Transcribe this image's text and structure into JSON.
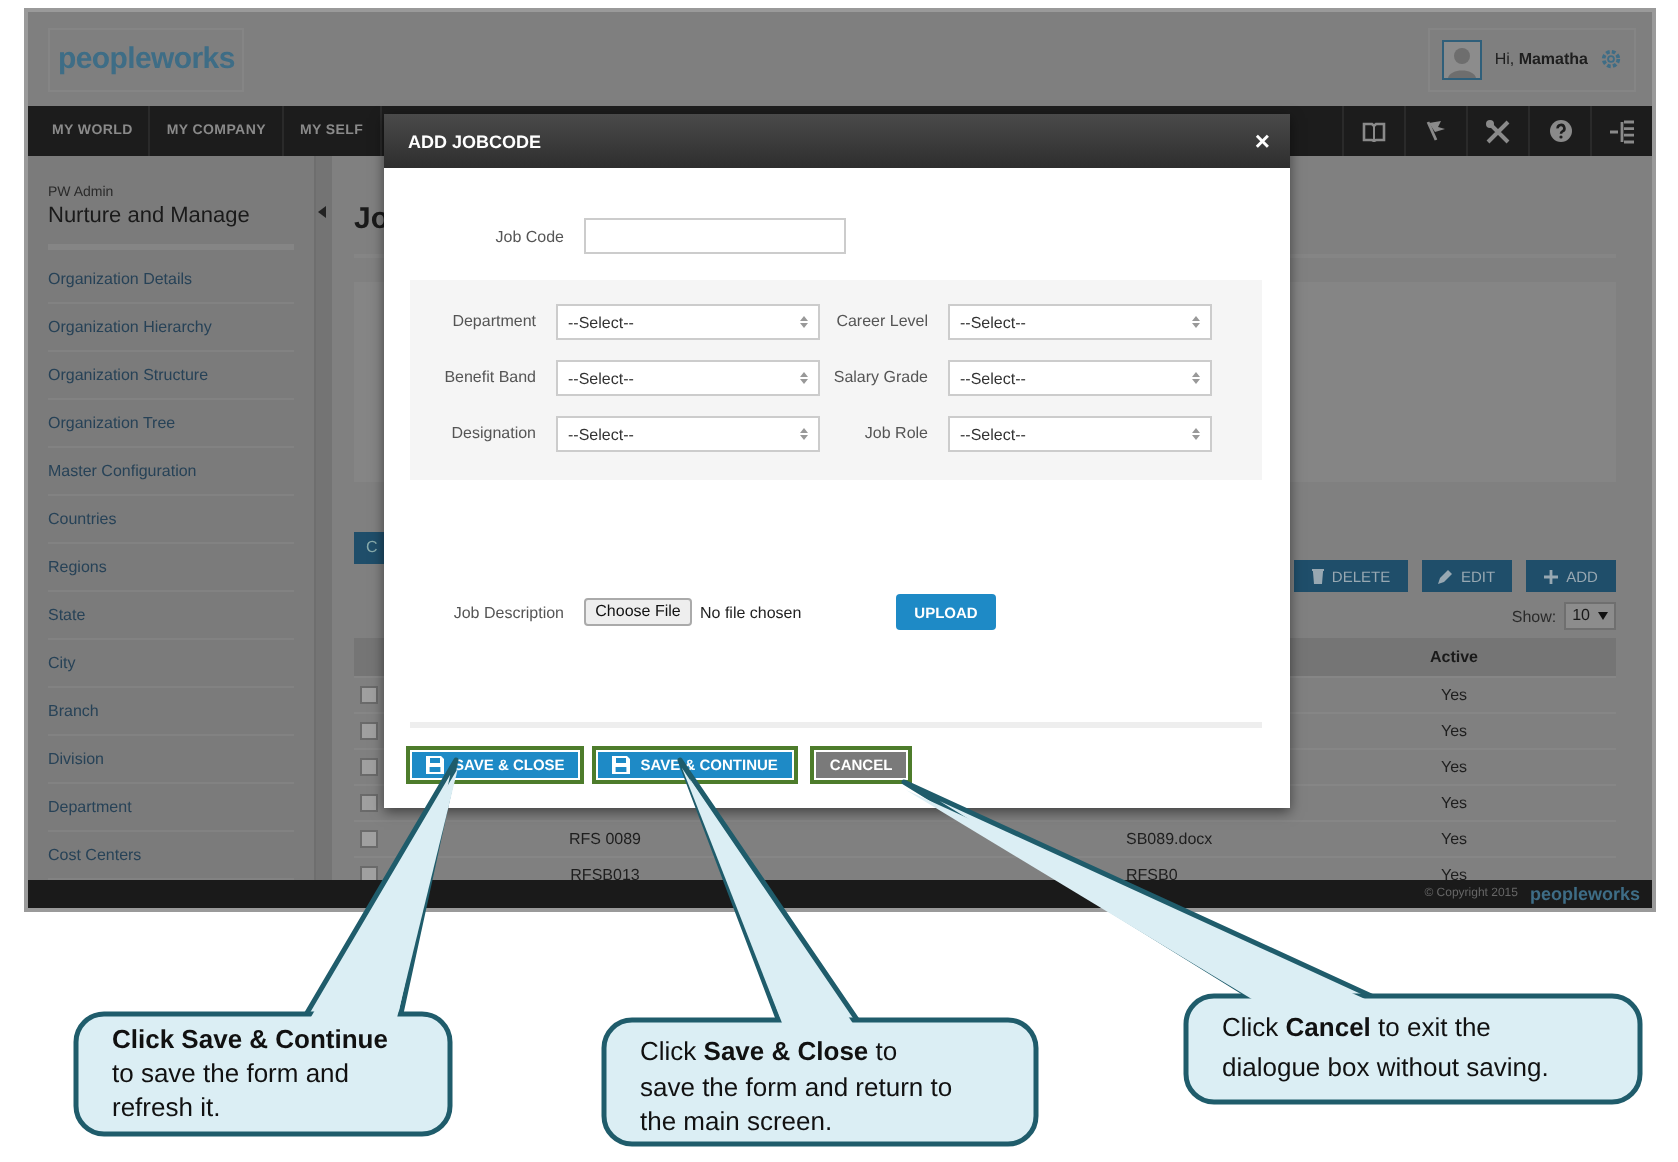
{
  "header": {
    "logo": "peopleworks",
    "greeting": "Hi, **Mamatha**"
  },
  "nav": {
    "items": [
      {
        "label": "MY WORLD"
      },
      {
        "label": "MY COMPANY"
      },
      {
        "label": "MY SELF"
      }
    ]
  },
  "sidebar": {
    "caption": "PW Admin",
    "title": "Nurture and Manage",
    "items": [
      "Organization Details",
      "Organization Hierarchy",
      "Organization Structure",
      "Organization Tree",
      "Master Configuration",
      "Countries",
      "Regions",
      "State",
      "City",
      "Branch",
      "Division",
      "Department",
      "Cost Centers"
    ]
  },
  "main": {
    "title": "Jo",
    "partial_button": "C",
    "actions": [
      {
        "kind": "delete",
        "label": "DELETE"
      },
      {
        "kind": "edit",
        "label": "EDIT"
      },
      {
        "kind": "add",
        "label": "ADD"
      }
    ],
    "show_label": "Show:",
    "show_value": "10",
    "table": {
      "columns": [
        "Active"
      ],
      "rows": [
        {
          "checked": false,
          "active": "Yes"
        },
        {
          "checked": false,
          "active": "Yes"
        },
        {
          "checked": false,
          "active": "Yes"
        },
        {
          "checked": false,
          "active": "Yes"
        },
        {
          "checked": false,
          "column_2": "RFS 0089",
          "column_3": "SB089.docx",
          "active": "Yes"
        },
        {
          "checked": false,
          "column_2": "RFSB013",
          "column_3": "RFSB0",
          "active": "Yes"
        }
      ]
    }
  },
  "footer": {
    "copyright": "© Copyright 2015",
    "logo": "peopleworks"
  },
  "dialog": {
    "title": "ADD JOBCODE",
    "close": "×",
    "job_code": {
      "label": "Job Code"
    },
    "fields": [
      {
        "label": "Department",
        "value": "--Select--"
      },
      {
        "label": "Career Level",
        "value": "--Select--"
      },
      {
        "label": "Benefit Band",
        "value": "--Select--"
      },
      {
        "label": "Salary Grade",
        "value": "--Select--"
      },
      {
        "label": "Designation",
        "value": "--Select--"
      },
      {
        "label": "Job Role",
        "value": "--Select--"
      }
    ],
    "file": {
      "label": "Job Description",
      "button": "Choose File",
      "status": "No file chosen",
      "upload": "UPLOAD"
    },
    "buttons": [
      {
        "kind": "save",
        "label": "SAVE & CLOSE",
        "highlighted": true
      },
      {
        "kind": "save",
        "label": "SAVE & CONTINUE",
        "highlighted": true
      },
      {
        "kind": "plain",
        "label": "CANCEL",
        "highlighted": true
      }
    ]
  },
  "callouts": [
    {
      "lines": [
        "**Click Save & Continue**",
        "to save the form and",
        "refresh it."
      ]
    },
    {
      "lines": [
        "Click **Save & Close** to",
        "save the form and return to",
        "the main screen."
      ]
    },
    {
      "lines": [
        "Click **Cancel** to exit the",
        "dialogue box without saving."
      ]
    }
  ]
}
